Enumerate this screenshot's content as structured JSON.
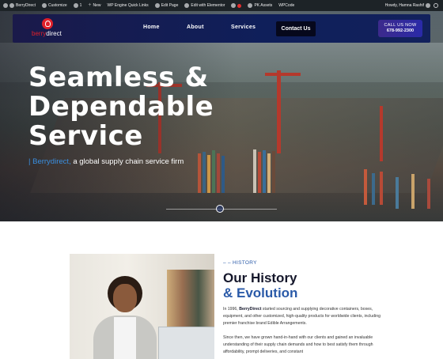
{
  "admin_bar": {
    "items": [
      "BerryDirect",
      "Customize",
      "1",
      "New",
      "WP Engine Quick Links",
      "Edit Page",
      "Edit with Elementor",
      "PK Assets",
      "WPCode"
    ],
    "greeting": "Howdy, Hamna Rashif"
  },
  "nav": {
    "logo_part1": "berry",
    "logo_part2": "direct",
    "links": [
      "Home",
      "About",
      "Services",
      "Contact Us"
    ],
    "call_label": "CALL US NOW",
    "phone": "678-992-2300"
  },
  "hero": {
    "line1": "Seamless &",
    "line2": "Dependable",
    "line3": "Service",
    "tag_bar": "|",
    "tag_brand": "Berrydirect,",
    "tag_rest": "a global supply chain service firm"
  },
  "history": {
    "kicker": "– – HISTORY",
    "title": "Our History",
    "subtitle": "& Evolution",
    "p1_a": "In 1996,",
    "p1_brand": "BerryDirect",
    "p1_b": "started sourcing and supplying decorative containers, boxes, equipment, and other customized, high-quality products for worldwide clients, including premier franchise brand Edible Arrangements.",
    "p2": "Since then, we have grown hand-in-hand with our clients and gained an invaluable understanding of their supply chain demands and how to best satisfy them through affordability, prompt deliveries, and constant"
  },
  "colors": {
    "brand_red": "#e0202a",
    "nav_bg": "#0f1f5a",
    "accent_blue": "#2a5aa8"
  }
}
